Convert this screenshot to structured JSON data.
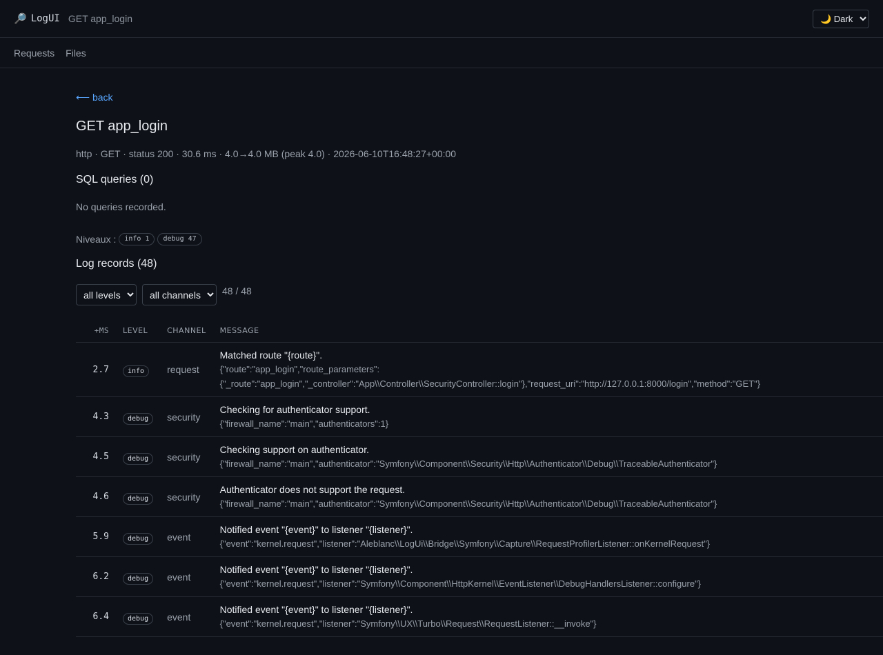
{
  "header": {
    "logo_icon": "magnifier-icon",
    "logo_text": "LogUI",
    "crumb": "GET app_login",
    "theme_selected": "🌙 Dark"
  },
  "nav": {
    "items": [
      "Requests",
      "Files"
    ]
  },
  "page": {
    "back_label": "⟵ back",
    "title": "GET app_login",
    "meta": "http · GET · status 200 · 30.6 ms · 4.0→4.0 MB (peak 4.0) · 2026-06-10T16:48:27+00:00",
    "sql_heading": "SQL queries (0)",
    "no_queries": "No queries recorded.",
    "levels_label": "Niveaux :",
    "level_pills": [
      "info 1",
      "debug 47"
    ],
    "log_heading": "Log records (48)",
    "level_filter": "all levels",
    "channel_filter": "all channels",
    "count": "48 / 48"
  },
  "table": {
    "columns": [
      "+ms",
      "Level",
      "Channel",
      "Message"
    ],
    "rows": [
      {
        "ms": "2.7",
        "level": "info",
        "channel": "request",
        "message": "Matched route \"{route}\".",
        "context": "{\"route\":\"app_login\",\"route_parameters\":{\"_route\":\"app_login\",\"_controller\":\"App\\\\Controller\\\\SecurityController::login\"},\"request_uri\":\"http://127.0.0.1:8000/login\",\"method\":\"GET\"}"
      },
      {
        "ms": "4.3",
        "level": "debug",
        "channel": "security",
        "message": "Checking for authenticator support.",
        "context": "{\"firewall_name\":\"main\",\"authenticators\":1}"
      },
      {
        "ms": "4.5",
        "level": "debug",
        "channel": "security",
        "message": "Checking support on authenticator.",
        "context": "{\"firewall_name\":\"main\",\"authenticator\":\"Symfony\\\\Component\\\\Security\\\\Http\\\\Authenticator\\\\Debug\\\\TraceableAuthenticator\"}"
      },
      {
        "ms": "4.6",
        "level": "debug",
        "channel": "security",
        "message": "Authenticator does not support the request.",
        "context": "{\"firewall_name\":\"main\",\"authenticator\":\"Symfony\\\\Component\\\\Security\\\\Http\\\\Authenticator\\\\Debug\\\\TraceableAuthenticator\"}"
      },
      {
        "ms": "5.9",
        "level": "debug",
        "channel": "event",
        "message": "Notified event \"{event}\" to listener \"{listener}\".",
        "context": "{\"event\":\"kernel.request\",\"listener\":\"Aleblanc\\\\LogUi\\\\Bridge\\\\Symfony\\\\Capture\\\\RequestProfilerListener::onKernelRequest\"}"
      },
      {
        "ms": "6.2",
        "level": "debug",
        "channel": "event",
        "message": "Notified event \"{event}\" to listener \"{listener}\".",
        "context": "{\"event\":\"kernel.request\",\"listener\":\"Symfony\\\\Component\\\\HttpKernel\\\\EventListener\\\\DebugHandlersListener::configure\"}"
      },
      {
        "ms": "6.4",
        "level": "debug",
        "channel": "event",
        "message": "Notified event \"{event}\" to listener \"{listener}\".",
        "context": "{\"event\":\"kernel.request\",\"listener\":\"Symfony\\\\UX\\\\Turbo\\\\Request\\\\RequestListener::__invoke\"}"
      }
    ]
  }
}
